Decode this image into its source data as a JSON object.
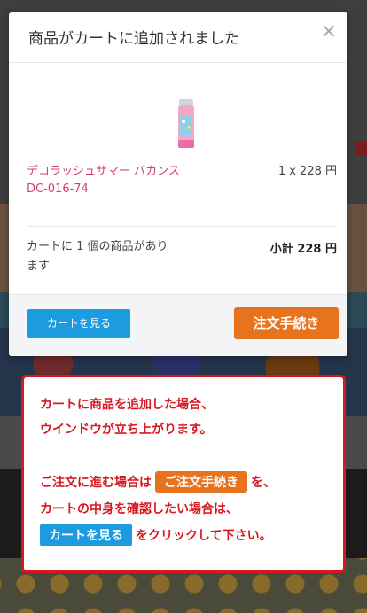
{
  "modal": {
    "title": "商品がカートに追加されました",
    "close": "×",
    "product": {
      "name": "デコラッシュサマー バカンス",
      "code": "DC-016-74",
      "quantity_price": "1 x 228 円"
    },
    "summary_text": "カートに 1 個の商品があります",
    "subtotal": "小計 228 円",
    "view_cart_label": "カートを見る",
    "checkout_label": "注文手続き"
  },
  "callout": {
    "line1": "カートに商品を追加した場合、",
    "line2": "ウインドウが立ち上がります。",
    "line3_prefix": "ご注文に進む場合は",
    "line3_badge": "ご注文手続き",
    "line3_suffix": "を、",
    "line4": "カートの中身を確認したい場合は、",
    "line5_badge": "カートを見る",
    "line5_suffix": "をクリックして下さい。"
  },
  "colors": {
    "accent_red": "#d8171f",
    "checkout_orange": "#e8731f",
    "cart_blue": "#1c9be0",
    "product_pink": "#d43f7a"
  }
}
